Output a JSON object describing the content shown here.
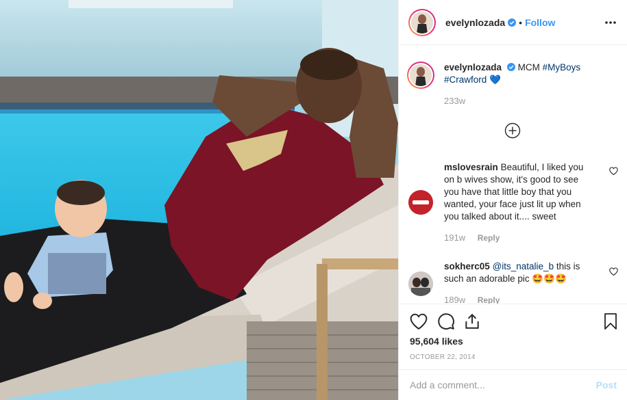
{
  "photo": {
    "alt_subject": "man-and-baby-by-pool"
  },
  "header": {
    "username": "evelynlozada",
    "verified_icon": "verified-badge-icon",
    "dot": "•",
    "follow_label": "Follow",
    "more_icon": "more-options-icon"
  },
  "caption": {
    "username": "evelynlozada",
    "text": "MCM",
    "tags": [
      "#MyBoys",
      "#Crawford"
    ],
    "emoji": "💙",
    "time": "233w"
  },
  "load_more_icon": "plus-circle-icon",
  "comments": [
    {
      "username": "mslovesrain",
      "text": "Beautiful, I liked you on b wives show, it's good to see you have that little boy that you wanted, your face just lit up when you talked about it.... sweet",
      "time": "191w",
      "reply_label": "Reply"
    },
    {
      "username": "sokherc05",
      "mention": "@its_natalie_b",
      "text": "this is such an adorable pic 🤩🤩🤩",
      "time": "189w",
      "reply_label": "Reply"
    }
  ],
  "actions": {
    "like_icon": "heart-icon",
    "comment_icon": "comment-icon",
    "share_icon": "share-icon",
    "save_icon": "bookmark-icon",
    "likes_text": "95,604 likes",
    "date_text": "OCTOBER 22, 2014"
  },
  "add_comment": {
    "placeholder": "Add a comment...",
    "post_label": "Post"
  },
  "colors": {
    "accent": "#3897f0",
    "muted": "#999999",
    "hashtag": "#003569",
    "post_disabled": "#b2dffc"
  }
}
